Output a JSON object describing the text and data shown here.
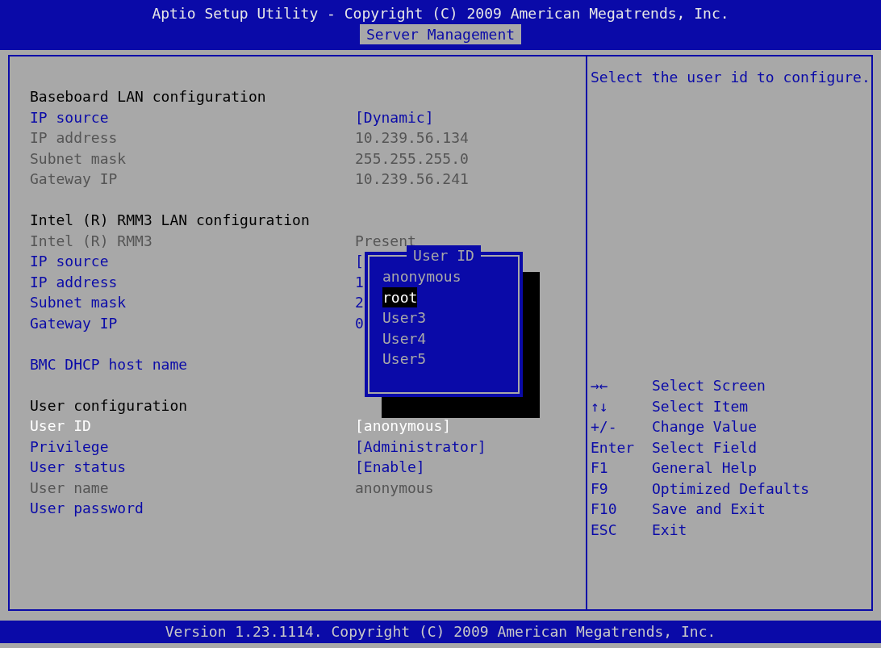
{
  "header": {
    "title": "Aptio Setup Utility - Copyright (C) 2009 American Megatrends, Inc."
  },
  "tabs": [
    {
      "label": "Server Management",
      "selected": true
    }
  ],
  "rows": [
    {
      "kind": "heading",
      "label": "Baseboard LAN configuration"
    },
    {
      "kind": "item",
      "label": "IP source",
      "value": "[Dynamic]",
      "selected": false
    },
    {
      "kind": "info",
      "label": "IP address",
      "value": "10.239.56.134"
    },
    {
      "kind": "info",
      "label": "Subnet mask",
      "value": "255.255.255.0"
    },
    {
      "kind": "info",
      "label": "Gateway IP",
      "value": "10.239.56.241"
    },
    {
      "kind": "blank"
    },
    {
      "kind": "heading",
      "label": "Intel (R) RMM3 LAN configuration"
    },
    {
      "kind": "info",
      "label": "Intel (R) RMM3",
      "value": "Present"
    },
    {
      "kind": "item",
      "label": "IP source",
      "value": "[",
      "selected": false
    },
    {
      "kind": "item",
      "label": "IP address",
      "value": "1",
      "selected": false
    },
    {
      "kind": "item",
      "label": "Subnet mask",
      "value": "2",
      "selected": false
    },
    {
      "kind": "item",
      "label": "Gateway IP",
      "value": "0",
      "selected": false
    },
    {
      "kind": "blank"
    },
    {
      "kind": "item",
      "label": "BMC DHCP host name",
      "selected": false
    },
    {
      "kind": "blank"
    },
    {
      "kind": "heading",
      "label": "User configuration"
    },
    {
      "kind": "item",
      "label": "User ID",
      "value": "[anonymous]",
      "selected": true
    },
    {
      "kind": "item",
      "label": "Privilege",
      "value": "[Administrator]",
      "selected": false
    },
    {
      "kind": "item",
      "label": "User status",
      "value": "[Enable]",
      "selected": false
    },
    {
      "kind": "info",
      "label": "User name",
      "value": "anonymous"
    },
    {
      "kind": "item",
      "label": "User password",
      "selected": false
    }
  ],
  "popup": {
    "title": "User ID",
    "options": [
      {
        "label": "anonymous",
        "selected": false
      },
      {
        "label": "root",
        "selected": true
      },
      {
        "label": "User3",
        "selected": false
      },
      {
        "label": "User4",
        "selected": false
      },
      {
        "label": "User5",
        "selected": false
      }
    ]
  },
  "help": {
    "description": "Select the user id to configure.",
    "keys": [
      {
        "key": "→←",
        "action": "Select Screen"
      },
      {
        "key": "↑↓",
        "action": "Select Item"
      },
      {
        "key": "+/-",
        "action": "Change Value"
      },
      {
        "key": "Enter",
        "action": "Select Field"
      },
      {
        "key": "F1",
        "action": "General Help"
      },
      {
        "key": "F9",
        "action": "Optimized Defaults"
      },
      {
        "key": "F10",
        "action": "Save and Exit"
      },
      {
        "key": "ESC",
        "action": "Exit"
      }
    ]
  },
  "footer": {
    "text": "Version 1.23.1114. Copyright (C) 2009 American Megatrends, Inc."
  }
}
